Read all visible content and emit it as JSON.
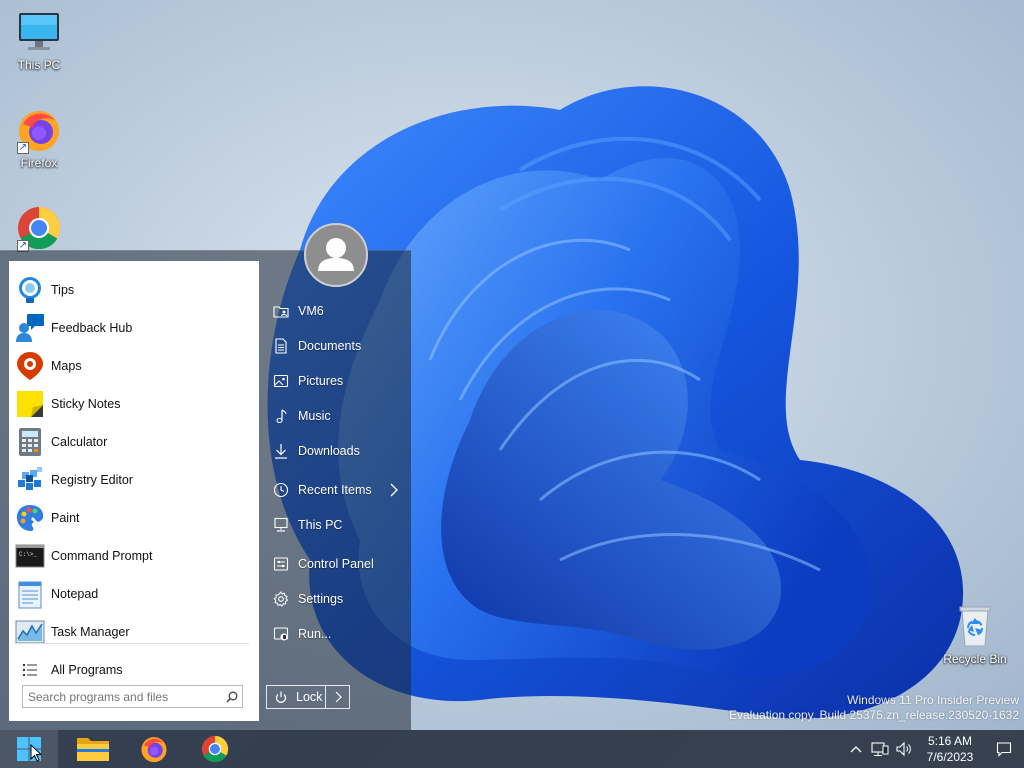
{
  "desktop": {
    "icons": [
      {
        "label": "This PC",
        "icon": "monitor-icon"
      },
      {
        "label": "Firefox",
        "icon": "firefox-icon"
      },
      {
        "label": "",
        "icon": "chrome-icon"
      },
      {
        "label": "Recycle Bin",
        "icon": "recycle-bin-icon"
      }
    ],
    "watermark": {
      "line1": "Windows 11 Pro Insider Preview",
      "line2": "Evaluation copy. Build 25375.zn_release.230520-1632"
    }
  },
  "start_menu": {
    "programs": [
      {
        "label": "Tips",
        "icon": "tips-icon"
      },
      {
        "label": "Feedback Hub",
        "icon": "feedback-hub-icon"
      },
      {
        "label": "Maps",
        "icon": "maps-icon"
      },
      {
        "label": "Sticky Notes",
        "icon": "sticky-notes-icon"
      },
      {
        "label": "Calculator",
        "icon": "calculator-icon"
      },
      {
        "label": "Registry Editor",
        "icon": "registry-editor-icon"
      },
      {
        "label": "Paint",
        "icon": "paint-icon"
      },
      {
        "label": "Command Prompt",
        "icon": "command-prompt-icon"
      },
      {
        "label": "Notepad",
        "icon": "notepad-icon"
      },
      {
        "label": "Task Manager",
        "icon": "task-manager-icon"
      }
    ],
    "all_programs": "All Programs",
    "search": {
      "placeholder": "Search programs and files"
    },
    "places": [
      {
        "label": "VM6",
        "icon": "user-folder-icon"
      },
      {
        "label": "Documents",
        "icon": "document-icon"
      },
      {
        "label": "Pictures",
        "icon": "picture-icon"
      },
      {
        "label": "Music",
        "icon": "music-note-icon"
      },
      {
        "label": "Downloads",
        "icon": "download-icon"
      },
      {
        "label": "Recent Items",
        "icon": "clock-icon",
        "has_submenu": true
      },
      {
        "label": "This PC",
        "icon": "computer-icon"
      },
      {
        "label": "Control Panel",
        "icon": "control-panel-icon"
      },
      {
        "label": "Settings",
        "icon": "gear-icon"
      },
      {
        "label": "Run...",
        "icon": "run-icon"
      }
    ],
    "lock_label": "Lock"
  },
  "taskbar": {
    "pinned": [
      "start-icon",
      "file-explorer-icon",
      "firefox-icon",
      "chrome-icon"
    ],
    "time": "5:16 AM",
    "date": "7/6/2023"
  },
  "colors": {
    "accent": "#1a6cf0",
    "taskbar": "#1e2837",
    "menu_left_bg": "#ffffff"
  }
}
